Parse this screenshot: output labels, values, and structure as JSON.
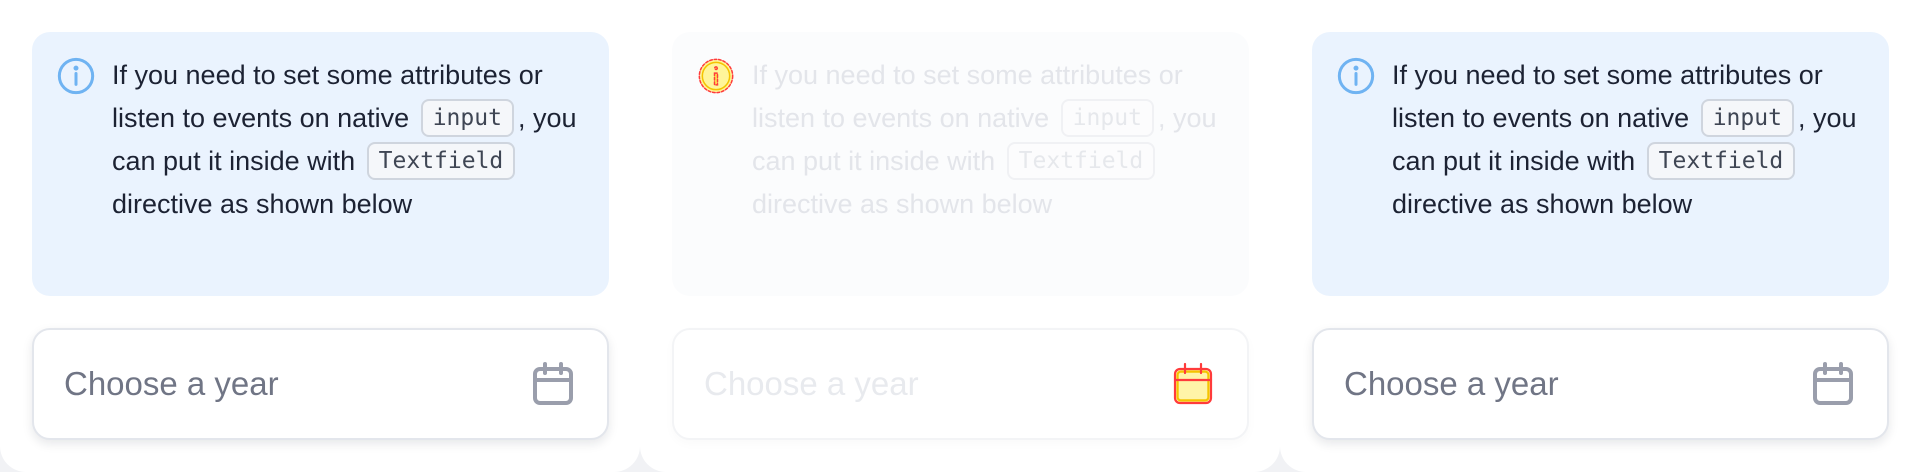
{
  "colors": {
    "info_bg": "#eaf3fe",
    "info_icon": "#6fb3f2",
    "text": "#1c2233",
    "placeholder": "#707585",
    "calendar_icon": "#9a9eac",
    "disabled_icon_stroke": "#ff3b3b",
    "disabled_icon_fill": "#ffe84d"
  },
  "panels": [
    {
      "state": "default",
      "alert": {
        "icon": "info-circle-icon",
        "text_1": "If you need to set some attributes or listen to events on native",
        "code_1": "input",
        "text_2": ", you can put it inside with",
        "code_2": "Textfield",
        "text_3": "directive as shown below"
      },
      "field": {
        "placeholder": "Choose a year",
        "icon": "calendar-icon"
      }
    },
    {
      "state": "disabled",
      "alert": {
        "icon": "info-circle-icon",
        "text_1": "If you need to set some attributes or listen to events on native",
        "code_1": "input",
        "text_2": ", you can put it inside with",
        "code_2": "Textfield",
        "text_3": "directive as shown below"
      },
      "field": {
        "placeholder": "Choose a year",
        "icon": "calendar-icon"
      }
    },
    {
      "state": "default",
      "alert": {
        "icon": "info-circle-icon",
        "text_1": "If you need to set some attributes or listen to events on native",
        "code_1": "input",
        "text_2": ", you can put it inside with",
        "code_2": "Textfield",
        "text_3": "directive as shown below"
      },
      "field": {
        "placeholder": "Choose a year",
        "icon": "calendar-icon"
      }
    }
  ]
}
